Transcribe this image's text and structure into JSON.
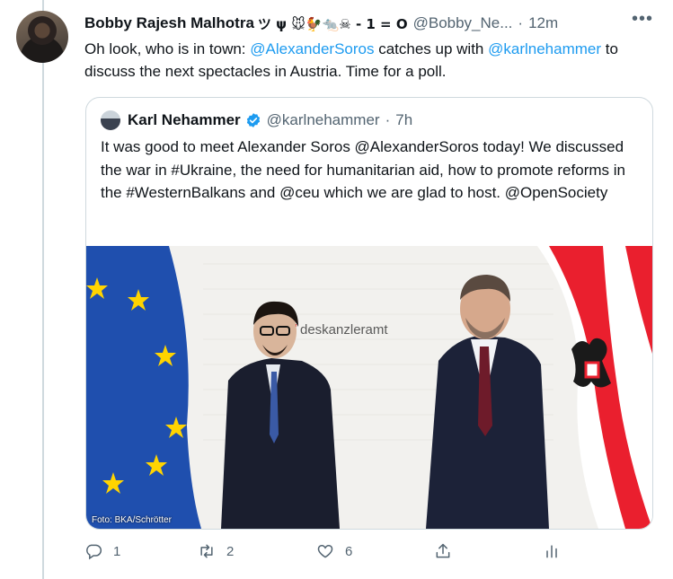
{
  "tweet": {
    "author_name": "Bobby Rajesh Malhotra",
    "author_emoji": "ツ ψ 🐭🐓🐀☠ - 1 = O",
    "author_handle": "@Bobby_Ne...",
    "separator": "·",
    "time": "12m",
    "more_label": "•••",
    "text_part1": "Oh look, who is in town: ",
    "mention1": "@AlexanderSoros",
    "text_part2": " catches up with ",
    "mention2": "@karlnehammer",
    "text_part3": " to discuss the next spectacles in Austria. Time for a poll."
  },
  "quote": {
    "author_name": "Karl Nehammer",
    "author_handle": "@karlnehammer",
    "separator": "·",
    "time": "7h",
    "text": "It was good to meet Alexander Soros @AlexanderSoros today! We discussed the war in #Ukraine, the need for humanitarian aid, how to promote reforms in the #WesternBalkans and @ceu which we are glad to host. @OpenSociety",
    "photo_wall_text": "deskanzleramt",
    "photo_credit": "Foto: BKA/Schrötter"
  },
  "actions": {
    "reply_count": "1",
    "retweet_count": "2",
    "like_count": "6"
  },
  "colors": {
    "link": "#1d9bf0",
    "secondary_text": "#536471",
    "border": "#cfd9de",
    "eu_blue": "#1f4fae",
    "austria_red": "#ea1f2e"
  }
}
